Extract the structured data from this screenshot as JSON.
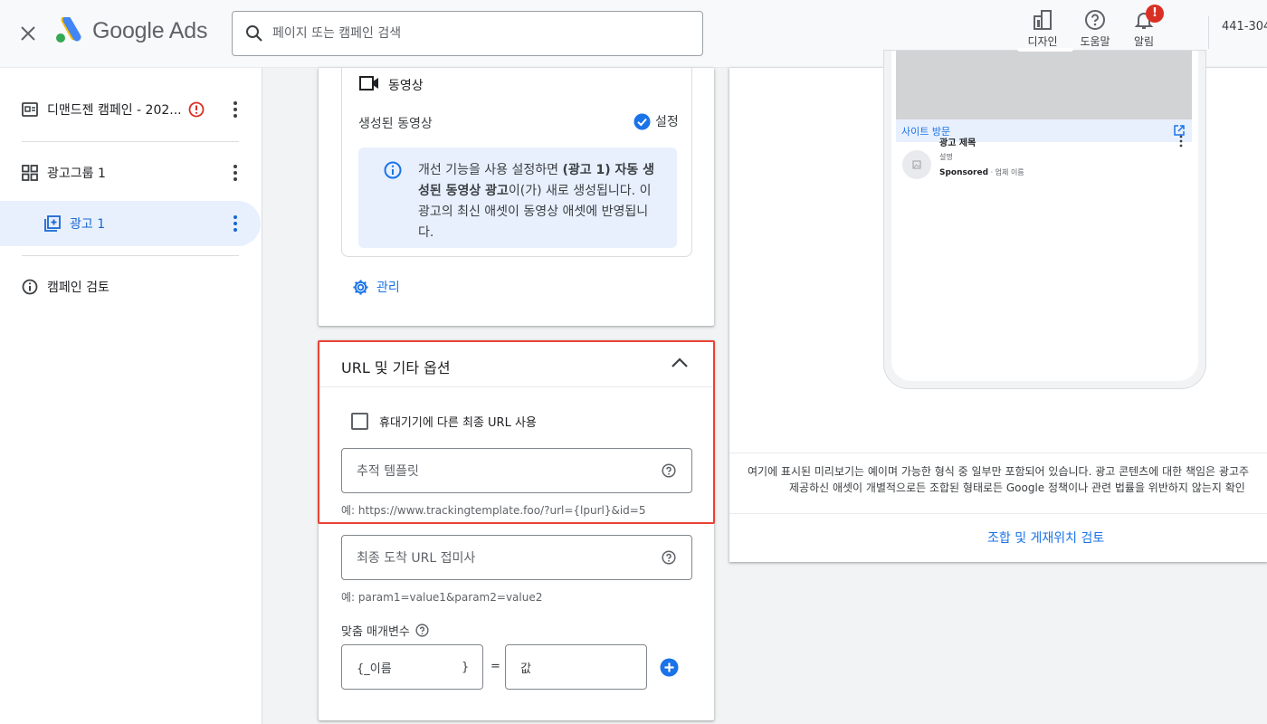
{
  "header": {
    "product_name": "Google Ads",
    "search_placeholder": "페이지 또는 캠페인 검색",
    "tools": {
      "design": "디자인",
      "help": "도움말",
      "notifications": "알림",
      "notification_badge": "!"
    },
    "account_id": "441-304-"
  },
  "sidebar": {
    "items": [
      {
        "label": "디맨드젠 캠페인 - 202...",
        "icon": "campaign-icon",
        "warning": true
      },
      {
        "label": "광고그룹 1",
        "icon": "ad-group-icon"
      },
      {
        "label": "광고 1",
        "icon": "ad-icon",
        "active": true
      },
      {
        "label": "캠페인 검토",
        "icon": "info-icon"
      }
    ]
  },
  "video_section": {
    "title": "동영상",
    "generated_label": "생성된 동영상",
    "status": "설정",
    "info_text_pre": "개선 기능을 사용 설정하면 ",
    "info_text_bold": "(광고 1) 자동 생성된 동영상 광고",
    "info_text_post": "이(가) 새로 생성됩니다. 이 광고의 최신 애셋이 동영상 애셋에 반영됩니다.",
    "manage_label": "관리"
  },
  "url_section": {
    "title": "URL 및 기타 옵션",
    "mobile_checkbox_label": "휴대기기에 다른 최종 URL 사용",
    "tracking_template_placeholder": "추적 템플릿",
    "tracking_template_hint": "예: https://www.trackingtemplate.foo/?url={lpurl}&id=5",
    "final_url_suffix_placeholder": "최종 도착 URL 접미사",
    "final_url_suffix_hint": "예: param1=value1&param2=value2",
    "custom_params_label": "맞춤 매개변수",
    "param_name_placeholder": "{_이름",
    "param_name_close": "}",
    "equals": "=",
    "param_value_placeholder": "값"
  },
  "preview": {
    "visit_site": "사이트 방문",
    "ad_title": "광고 제목",
    "ad_description": "설명",
    "sponsored": "Sponsored",
    "business_name": " · 업체 이름",
    "disclaimer_line1": "여기에 표시된 미리보기는 예이며 가능한 형식 중 일부만 포함되어 있습니다. 광고 콘텐츠에 대한 책임은 광고주",
    "disclaimer_line2": "제공하신 애셋이 개별적으로든 조합된 형태로든 Google 정책이나 관련 법률을 위반하지 않는지 확인",
    "review_link": "조합 및 게재위치 검토"
  },
  "colors": {
    "accent": "#1a73e8",
    "error": "#d93025",
    "highlight_border": "#ea4335",
    "info_bg": "#e8f0fe"
  }
}
